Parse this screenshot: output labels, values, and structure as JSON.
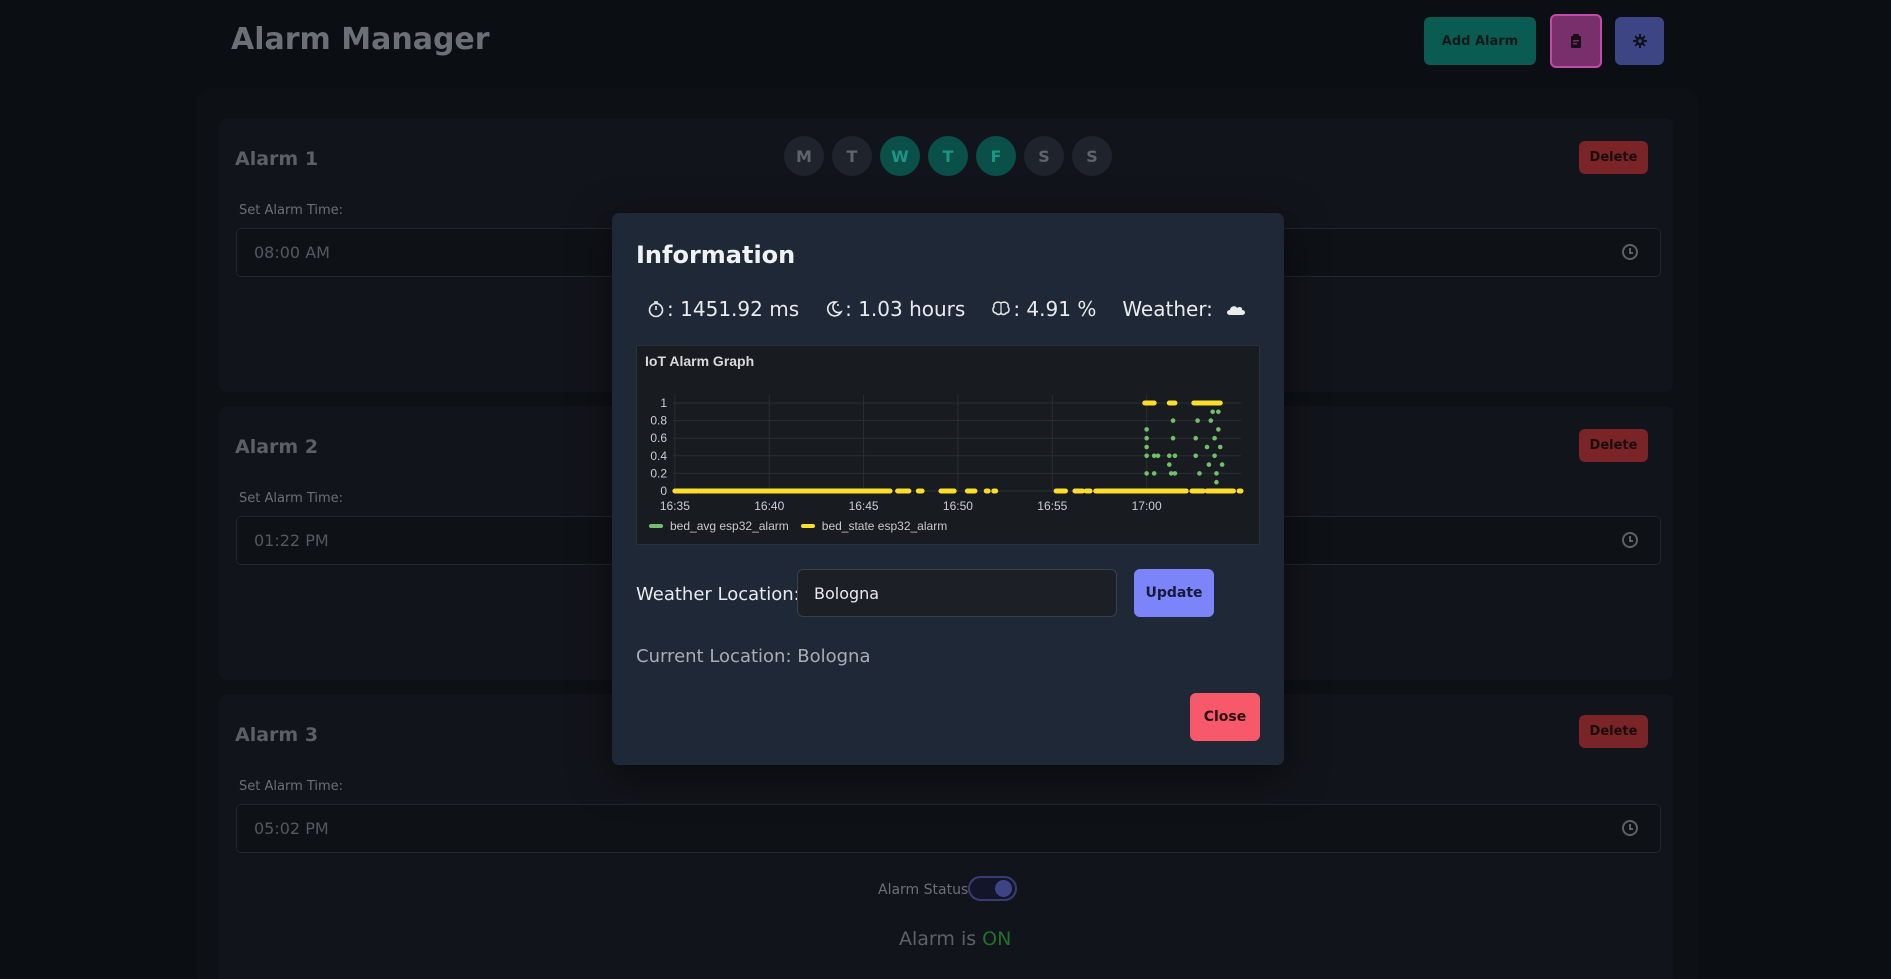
{
  "header": {
    "title": "Alarm Manager",
    "add_alarm_label": "Add Alarm",
    "reports_icon": "clipboard-icon",
    "settings_icon": "gear-icon"
  },
  "day_labels": [
    "M",
    "T",
    "W",
    "T",
    "F",
    "S",
    "S"
  ],
  "alarms": [
    {
      "title": "Alarm 1",
      "delete_label": "Delete",
      "time_label": "Set Alarm Time:",
      "time": "08:00 AM",
      "days_active": [
        false,
        false,
        true,
        true,
        true,
        false,
        false
      ]
    },
    {
      "title": "Alarm 2",
      "delete_label": "Delete",
      "time_label": "Set Alarm Time:",
      "time": "01:22 PM"
    },
    {
      "title": "Alarm 3",
      "delete_label": "Delete",
      "time_label": "Set Alarm Time:",
      "time": "05:02 PM",
      "status_label": "Alarm Status:",
      "status_prefix": "Alarm is",
      "status_value": "ON",
      "enabled": true
    }
  ],
  "modal": {
    "title": "Information",
    "stats": {
      "latency": ": 1451.92 ms",
      "sleep": ": 1.03 hours",
      "brain": ": 4.91 %",
      "weather_label": "Weather:",
      "weather_icon": "cloud-icon"
    },
    "location_label": "Weather Location:",
    "location_value": "Bologna",
    "update_label": "Update",
    "current_location": "Current Location: Bologna",
    "close_label": "Close"
  },
  "colors": {
    "bed_avg": "#73bf69",
    "bed_state": "#fade2a",
    "update": "#7c84fa",
    "close": "#f7596a"
  },
  "chart_data": {
    "type": "scatter",
    "title": "IoT Alarm Graph",
    "x_ticks": [
      "16:35",
      "16:40",
      "16:45",
      "16:50",
      "16:55",
      "17:00"
    ],
    "y_ticks": [
      "0",
      "0.2",
      "0.4",
      "0.6",
      "0.8",
      "1"
    ],
    "ylim": [
      0,
      1
    ],
    "xlim_minutes": [
      -0.1,
      30.0
    ],
    "x_unit": "minutes after 16:35",
    "series": [
      {
        "name": "bed_avg esp32_alarm",
        "points": [
          [
            25.0,
            0.2
          ],
          [
            25.0,
            0.4
          ],
          [
            25.0,
            0.5
          ],
          [
            25.0,
            0.6
          ],
          [
            25.0,
            0.7
          ],
          [
            25.4,
            0.2
          ],
          [
            25.4,
            0.4
          ],
          [
            25.6,
            0.4
          ],
          [
            26.2,
            0.3
          ],
          [
            26.2,
            0.4
          ],
          [
            26.3,
            0.2
          ],
          [
            26.4,
            0.6
          ],
          [
            26.4,
            0.8
          ],
          [
            26.5,
            0.4
          ],
          [
            26.5,
            0.2
          ],
          [
            27.6,
            0.4
          ],
          [
            27.6,
            0.6
          ],
          [
            27.7,
            0.8
          ],
          [
            27.8,
            0.2
          ],
          [
            28.2,
            0.5
          ],
          [
            28.3,
            0.3
          ],
          [
            28.4,
            0.8
          ],
          [
            28.5,
            0.9
          ],
          [
            28.6,
            0.6
          ],
          [
            28.6,
            0.4
          ],
          [
            28.7,
            0.2
          ],
          [
            28.7,
            0.1
          ],
          [
            28.8,
            0.9
          ],
          [
            28.8,
            0.7
          ],
          [
            28.9,
            0.5
          ],
          [
            29.0,
            0.3
          ]
        ]
      },
      {
        "name": "bed_state esp32_alarm",
        "segments": [
          [
            0.0,
            1.2,
            0
          ],
          [
            1.3,
            11.4,
            0
          ],
          [
            11.8,
            12.4,
            0
          ],
          [
            12.9,
            13.1,
            0
          ],
          [
            14.1,
            14.8,
            0
          ],
          [
            15.5,
            15.9,
            0
          ],
          [
            16.5,
            16.6,
            0
          ],
          [
            16.9,
            17.0,
            0
          ],
          [
            20.2,
            20.7,
            0
          ],
          [
            21.2,
            21.6,
            0
          ],
          [
            21.8,
            22.0,
            0
          ],
          [
            22.3,
            27.1,
            0
          ],
          [
            27.4,
            28.0,
            0
          ],
          [
            28.2,
            29.6,
            0
          ],
          [
            29.9,
            30.0,
            0
          ],
          [
            24.9,
            25.4,
            1
          ],
          [
            26.2,
            26.5,
            1
          ],
          [
            27.5,
            28.9,
            1
          ]
        ]
      }
    ],
    "legend_position": "bottom-left",
    "grid": true
  }
}
